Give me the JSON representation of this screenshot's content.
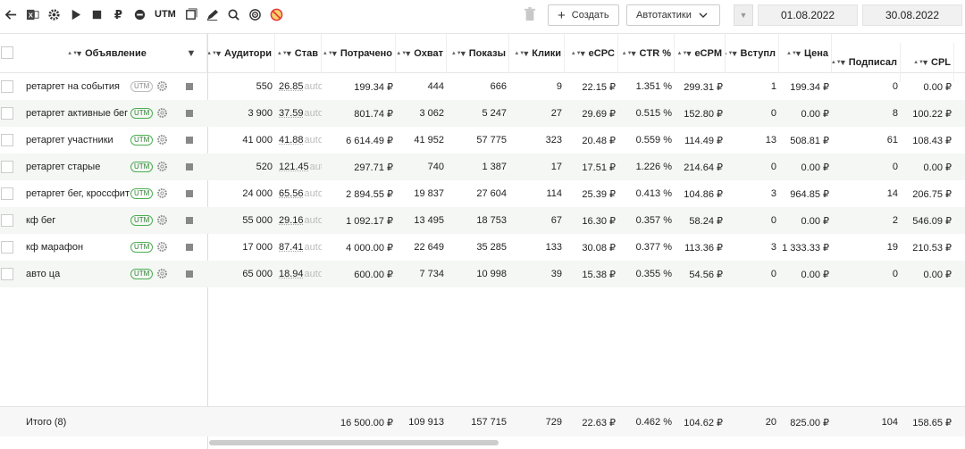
{
  "toolbar": {
    "icons": [
      "back-arrow-icon",
      "excel-icon",
      "gear-icon",
      "play-icon",
      "stop-icon",
      "ruble-icon",
      "minus-circle-icon"
    ],
    "utm_label": "UTM",
    "icons2": [
      "copy-icon",
      "edit-icon",
      "search-zoom-icon",
      "target-icon",
      "no-entry-icon"
    ],
    "create_label": "Создать",
    "autotactics_label": "Автотактики",
    "date_from": "01.08.2022",
    "date_to": "30.08.2022"
  },
  "columns": [
    {
      "key": "name",
      "label": "Объявление"
    },
    {
      "key": "aud",
      "label": "Аудитори"
    },
    {
      "key": "stav",
      "label": "Став"
    },
    {
      "key": "spent",
      "label": "Потрачено"
    },
    {
      "key": "reach",
      "label": "Охват"
    },
    {
      "key": "shows",
      "label": "Показы"
    },
    {
      "key": "clicks",
      "label": "Клики"
    },
    {
      "key": "ecpc",
      "label": "eCPC"
    },
    {
      "key": "ctr",
      "label": "CTR %"
    },
    {
      "key": "ecpm",
      "label": "eCPM"
    },
    {
      "key": "join",
      "label": "Вступл"
    },
    {
      "key": "price",
      "label": "Цена"
    },
    {
      "key": "subs",
      "label": "Подписал"
    },
    {
      "key": "cpl",
      "label": "CPL"
    }
  ],
  "rows": [
    {
      "name": "ретаргет на события",
      "utm_active": false,
      "aud": "550",
      "stav": "26.85",
      "spent": "199.34 ₽",
      "reach": "444",
      "shows": "666",
      "clicks": "9",
      "ecpc": "22.15 ₽",
      "ctr": "1.351 %",
      "ecpm": "299.31 ₽",
      "join": "1",
      "price": "199.34 ₽",
      "subs": "0",
      "cpl": "0.00 ₽"
    },
    {
      "name": "ретаргет активные бег",
      "utm_active": true,
      "aud": "3 900",
      "stav": "37.59",
      "spent": "801.74 ₽",
      "reach": "3 062",
      "shows": "5 247",
      "clicks": "27",
      "ecpc": "29.69 ₽",
      "ctr": "0.515 %",
      "ecpm": "152.80 ₽",
      "join": "0",
      "price": "0.00 ₽",
      "subs": "8",
      "cpl": "100.22 ₽"
    },
    {
      "name": "ретаргет участники",
      "utm_active": true,
      "aud": "41 000",
      "stav": "41.88",
      "spent": "6 614.49 ₽",
      "reach": "41 952",
      "shows": "57 775",
      "clicks": "323",
      "ecpc": "20.48 ₽",
      "ctr": "0.559 %",
      "ecpm": "114.49 ₽",
      "join": "13",
      "price": "508.81 ₽",
      "subs": "61",
      "cpl": "108.43 ₽"
    },
    {
      "name": "ретаргет старые",
      "utm_active": true,
      "aud": "520",
      "stav": "121.45",
      "spent": "297.71 ₽",
      "reach": "740",
      "shows": "1 387",
      "clicks": "17",
      "ecpc": "17.51 ₽",
      "ctr": "1.226 %",
      "ecpm": "214.64 ₽",
      "join": "0",
      "price": "0.00 ₽",
      "subs": "0",
      "cpl": "0.00 ₽"
    },
    {
      "name": "ретаргет бег, кроссфит",
      "utm_active": true,
      "aud": "24 000",
      "stav": "65.56",
      "spent": "2 894.55 ₽",
      "reach": "19 837",
      "shows": "27 604",
      "clicks": "114",
      "ecpc": "25.39 ₽",
      "ctr": "0.413 %",
      "ecpm": "104.86 ₽",
      "join": "3",
      "price": "964.85 ₽",
      "subs": "14",
      "cpl": "206.75 ₽"
    },
    {
      "name": "кф бег",
      "utm_active": true,
      "aud": "55 000",
      "stav": "29.16",
      "spent": "1 092.17 ₽",
      "reach": "13 495",
      "shows": "18 753",
      "clicks": "67",
      "ecpc": "16.30 ₽",
      "ctr": "0.357 %",
      "ecpm": "58.24 ₽",
      "join": "0",
      "price": "0.00 ₽",
      "subs": "2",
      "cpl": "546.09 ₽"
    },
    {
      "name": "кф марафон",
      "utm_active": true,
      "aud": "17 000",
      "stav": "87.41",
      "spent": "4 000.00 ₽",
      "reach": "22 649",
      "shows": "35 285",
      "clicks": "133",
      "ecpc": "30.08 ₽",
      "ctr": "0.377 %",
      "ecpm": "113.36 ₽",
      "join": "3",
      "price": "1 333.33 ₽",
      "subs": "19",
      "cpl": "210.53 ₽"
    },
    {
      "name": "авто ца",
      "utm_active": true,
      "aud": "65 000",
      "stav": "18.94",
      "spent": "600.00 ₽",
      "reach": "7 734",
      "shows": "10 998",
      "clicks": "39",
      "ecpc": "15.38 ₽",
      "ctr": "0.355 %",
      "ecpm": "54.56 ₽",
      "join": "0",
      "price": "0.00 ₽",
      "subs": "0",
      "cpl": "0.00 ₽"
    }
  ],
  "stav_suffix": "auto",
  "utm_badge": "UTM",
  "footer": {
    "label": "Итого (8)",
    "spent": "16 500.00 ₽",
    "reach": "109 913",
    "shows": "157 715",
    "clicks": "729",
    "ecpc": "22.63 ₽",
    "ctr": "0.462 %",
    "ecpm": "104.62 ₽",
    "join": "20",
    "price": "825.00 ₽",
    "subs": "104",
    "cpl": "158.65 ₽"
  },
  "colors": {
    "utm_active": "#4caf50",
    "row_alt": "#f4f7f4"
  }
}
